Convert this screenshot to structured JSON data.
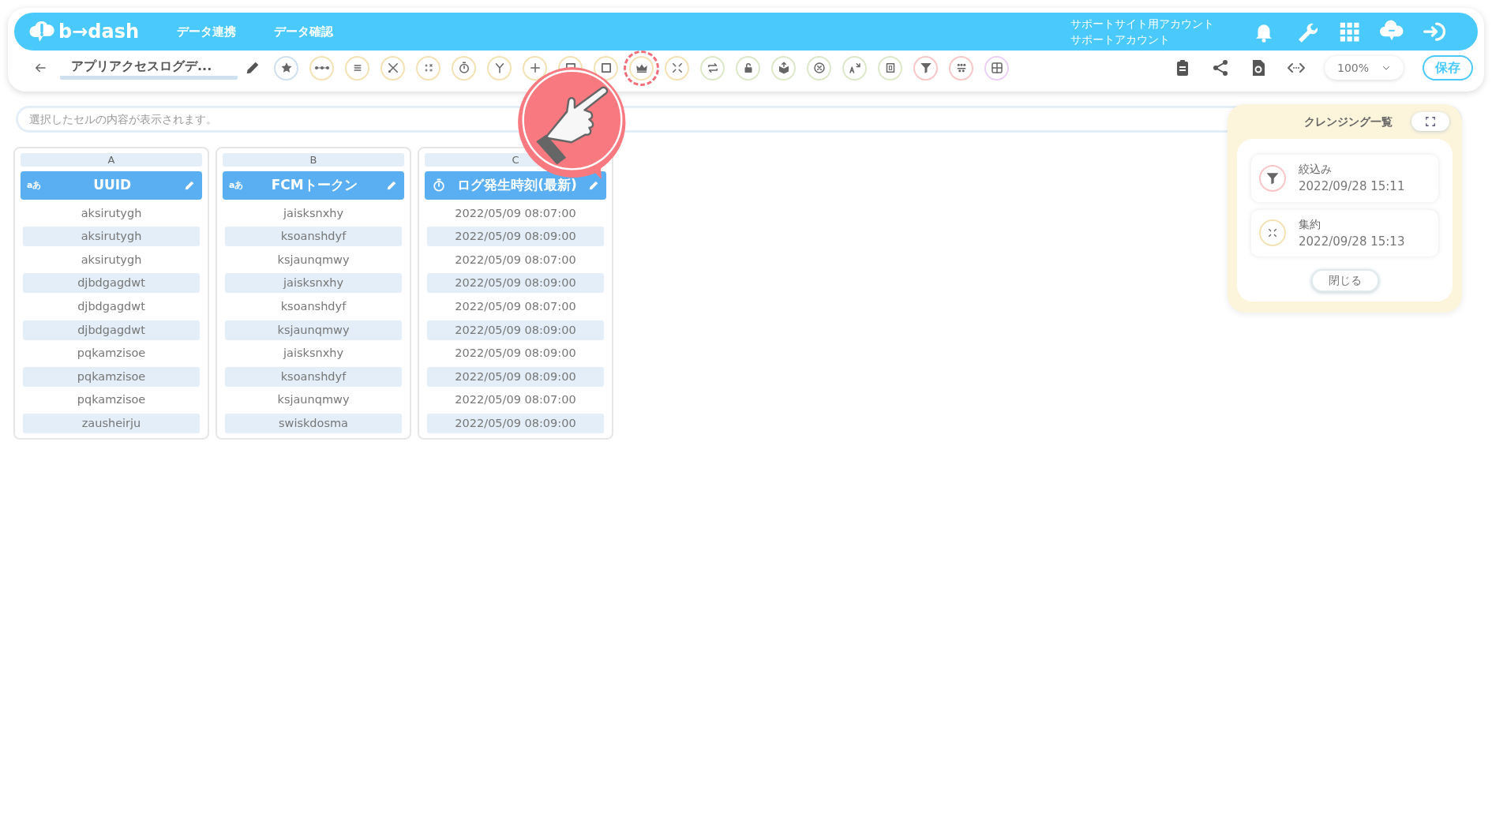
{
  "header": {
    "logo": "b→dash",
    "nav": [
      "データ連携",
      "データ確認"
    ],
    "account": [
      "サポートサイト用アカウント",
      "サポートアカウント"
    ]
  },
  "toolbar": {
    "title": "アプリアクセスログデ...",
    "tools": [
      {
        "color": "#cfe0f0",
        "highlighted": false
      },
      {
        "color": "#f3e2b3",
        "highlighted": false
      },
      {
        "color": "#f3e2b3",
        "highlighted": false
      },
      {
        "color": "#f3e2b3",
        "highlighted": false
      },
      {
        "color": "#f3e2b3",
        "highlighted": false
      },
      {
        "color": "#f3e2b3",
        "highlighted": false
      },
      {
        "color": "#f3e2b3",
        "highlighted": false
      },
      {
        "color": "#f3e2b3",
        "highlighted": false
      },
      {
        "color": "#f3e2b3",
        "highlighted": false
      },
      {
        "color": "#f3e2b3",
        "highlighted": false
      },
      {
        "color": "#f3e2b3",
        "highlighted": true
      },
      {
        "color": "#f3e2b3",
        "highlighted": false
      },
      {
        "color": "#dde8c8",
        "highlighted": false
      },
      {
        "color": "#dde8c8",
        "highlighted": false
      },
      {
        "color": "#dde8c8",
        "highlighted": false
      },
      {
        "color": "#dde8c8",
        "highlighted": false
      },
      {
        "color": "#dde8c8",
        "highlighted": false
      },
      {
        "color": "#dde8c8",
        "highlighted": false
      },
      {
        "color": "#f9c7c7",
        "highlighted": false
      },
      {
        "color": "#f9c7c7",
        "highlighted": false
      },
      {
        "color": "#ecd0f5",
        "highlighted": false
      }
    ],
    "zoom": "100%",
    "save": "保存"
  },
  "formula_bar": {
    "placeholder": "選択したセルの内容が表示されます。"
  },
  "columns": [
    {
      "letter": "A",
      "kind": "text",
      "type_badge": "aあ",
      "title": "UUID",
      "cells": [
        "aksirutygh",
        "aksirutygh",
        "aksirutygh",
        "djbdgagdwt",
        "djbdgagdwt",
        "djbdgagdwt",
        "pqkamzisoe",
        "pqkamzisoe",
        "pqkamzisoe",
        "zausheirju"
      ]
    },
    {
      "letter": "B",
      "kind": "text",
      "type_badge": "aあ",
      "title": "FCMトークン",
      "cells": [
        "jaisksnxhy",
        "ksoanshdyf",
        "ksjaunqmwy",
        "jaisksnxhy",
        "ksoanshdyf",
        "ksjaunqmwy",
        "jaisksnxhy",
        "ksoanshdyf",
        "ksjaunqmwy",
        "swiskdosma"
      ]
    },
    {
      "letter": "C",
      "kind": "datetime",
      "title": "ログ発生時刻(最新)",
      "cells": [
        "2022/05/09 08:07:00",
        "2022/05/09 08:09:00",
        "2022/05/09 08:07:00",
        "2022/05/09 08:09:00",
        "2022/05/09 08:07:00",
        "2022/05/09 08:09:00",
        "2022/05/09 08:09:00",
        "2022/05/09 08:09:00",
        "2022/05/09 08:07:00",
        "2022/05/09 08:09:00"
      ]
    }
  ],
  "cleansing_panel": {
    "title": "クレンジング一覧",
    "items": [
      {
        "kind": "filter",
        "name": "絞込み",
        "time": "2022/09/28 15:11",
        "color": "#f9c7c7"
      },
      {
        "kind": "aggregate",
        "name": "集約",
        "time": "2022/09/28 15:13",
        "color": "#f3e2b3"
      }
    ],
    "close": "閉じる"
  }
}
